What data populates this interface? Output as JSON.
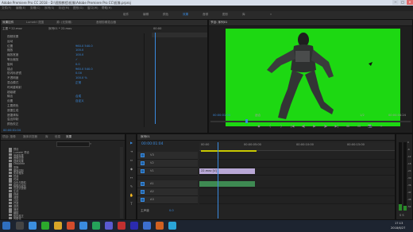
{
  "window": {
    "title": "Adobe Premiere Pro CC 2018 - D:\\视频教程\\抠像\\Adobe Premiere Pro CC\\抠像.prproj",
    "minimize": "─",
    "maximize": "□",
    "close": "✕"
  },
  "menu": [
    "文件(F)",
    "编辑(E)",
    "剪辑(C)",
    "序列(S)",
    "标记(M)",
    "图形(G)",
    "窗口(W)",
    "帮助(H)"
  ],
  "workspaces": {
    "items": [
      "组件",
      "编辑",
      "颜色",
      "效果",
      "音频",
      "图形",
      "库"
    ],
    "active": "效果",
    "overflow": "»"
  },
  "left_panel": {
    "tabs": [
      "效果控件",
      "Lumetri 范围",
      "源: (无剪辑)",
      "音频剪辑混合器"
    ],
    "active_tab": "效果控件",
    "master": "主要 * 22.mov",
    "sequence": "序列01 * 22.mov",
    "timecode": "00:00",
    "rows": [
      {
        "label": "视频效果",
        "value": ""
      },
      {
        "label": "运动",
        "value": ""
      },
      {
        "label": "位置",
        "value": "960.0   540.0"
      },
      {
        "label": "缩放",
        "value": "100.0"
      },
      {
        "label": "缩放宽度",
        "value": "100.0"
      },
      {
        "label": "等比缩放",
        "value": "✓"
      },
      {
        "label": "旋转",
        "value": "0.0"
      },
      {
        "label": "锚点",
        "value": "960.0   540.0"
      },
      {
        "label": "防闪烁滤镜",
        "value": "0.00"
      },
      {
        "label": "不透明度",
        "value": "100.0 %"
      },
      {
        "label": "混合模式",
        "value": "正常"
      },
      {
        "label": "时间重映射",
        "value": ""
      },
      {
        "label": "超级键",
        "value": ""
      },
      {
        "label": "输出",
        "value": "合成"
      },
      {
        "label": "设置",
        "value": "自定义"
      },
      {
        "label": "主要颜色",
        "value": ""
      },
      {
        "label": "遮罩生成",
        "value": ""
      },
      {
        "label": "遮罩清除",
        "value": ""
      },
      {
        "label": "溢出抑制",
        "value": ""
      },
      {
        "label": "颜色校正",
        "value": ""
      }
    ],
    "footer_time": "00:00:01:04"
  },
  "program": {
    "title": "节目: 序列01",
    "timecode": "00:00:01:04",
    "fit": "适合",
    "ratio": "1/2",
    "duration": "00:00:04:24",
    "controls": [
      "◆",
      "{",
      "}",
      "|◀",
      "◀|",
      "▶",
      "|▶",
      "▶|",
      "⊞",
      "⊟",
      "📷",
      "+"
    ]
  },
  "project": {
    "tabs": [
      "项目: 抠像",
      "媒体浏览器",
      "库",
      "信息",
      "效果"
    ],
    "active_tab": "效果",
    "search_placeholder": "",
    "tree": [
      "预设",
      "Lumetri 预设",
      "音频效果",
      "音频过渡",
      "视频效果",
      "Obsolete",
      "变换",
      "图像控制",
      "实用程序",
      "扭曲",
      "时间",
      "杂色与颗粒",
      "模糊与锐化",
      "沉浸式视频",
      "生成",
      "视频",
      "调整",
      "过时",
      "过渡",
      "透视",
      "通道",
      "键控",
      "颜色校正",
      "风格化"
    ]
  },
  "tools": [
    "▶",
    "⇥",
    "⇔",
    "◆",
    "↔",
    "✎",
    "✋",
    "T"
  ],
  "timeline": {
    "title": "序列01",
    "timecode": "00:00:01:04",
    "ruler": [
      "00:00",
      "00:00:05:00",
      "00:00:10:00",
      "00:00:15:00"
    ],
    "video_tracks": [
      "V3",
      "V2",
      "V1"
    ],
    "audio_tracks": [
      "A1",
      "A2",
      "A3"
    ],
    "master": "主声道",
    "master_value": "0.0",
    "clip_label": "22.mov [V]",
    "audio_clip_label": ""
  },
  "audio_meter": {
    "scale": [
      "0",
      "-6",
      "-12",
      "-18",
      "-24",
      "-30",
      "-36",
      "-42",
      "-48",
      "-54"
    ],
    "footer": "S S"
  },
  "taskbar": {
    "time": "17:13",
    "date": "2018/6/27"
  },
  "colors": {
    "accent": "#3a8be0",
    "chroma_green": "#1dd812",
    "playhead": "#3a8be0"
  }
}
